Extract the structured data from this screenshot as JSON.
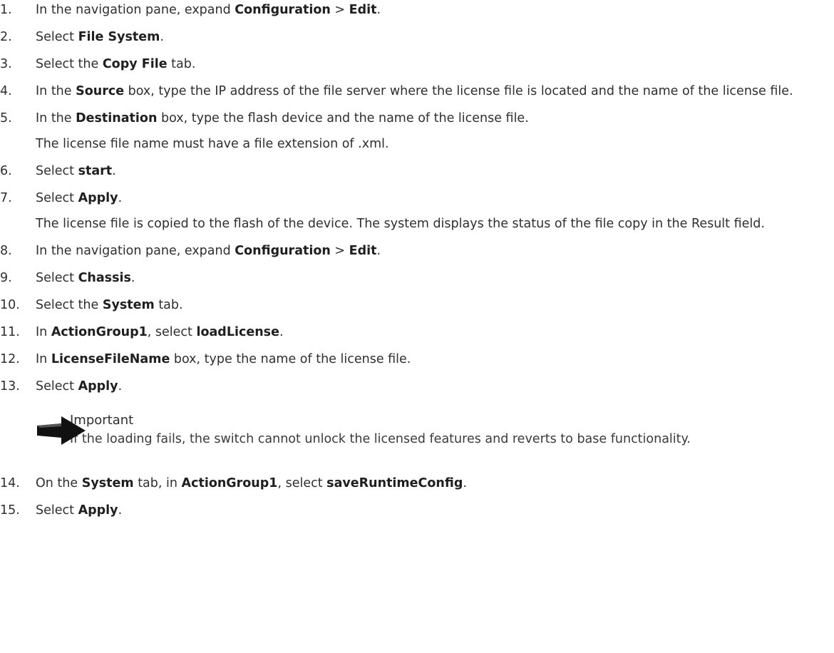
{
  "steps_a": [
    {
      "num": "1.",
      "parts": [
        {
          "t": "In the navigation pane, expand "
        },
        {
          "t": "Configuration",
          "b": true
        },
        {
          "t": " > "
        },
        {
          "t": "Edit",
          "b": true
        },
        {
          "t": "."
        }
      ]
    },
    {
      "num": "2.",
      "parts": [
        {
          "t": "Select "
        },
        {
          "t": "File System",
          "b": true
        },
        {
          "t": "."
        }
      ]
    },
    {
      "num": "3.",
      "parts": [
        {
          "t": "Select the "
        },
        {
          "t": "Copy File",
          "b": true
        },
        {
          "t": " tab."
        }
      ]
    },
    {
      "num": "4.",
      "parts": [
        {
          "t": "In the "
        },
        {
          "t": "Source",
          "b": true
        },
        {
          "t": " box, type the IP address of the file server where the license file is located and the name of the license file."
        }
      ]
    },
    {
      "num": "5.",
      "parts": [
        {
          "t": "In the "
        },
        {
          "t": "Destination",
          "b": true
        },
        {
          "t": " box, type the flash device and the name of the license file."
        }
      ],
      "note": "The license file name must have a file extension of .xml."
    },
    {
      "num": "6.",
      "parts": [
        {
          "t": "Select "
        },
        {
          "t": "start",
          "b": true
        },
        {
          "t": "."
        }
      ]
    },
    {
      "num": "7.",
      "parts": [
        {
          "t": "Select "
        },
        {
          "t": "Apply",
          "b": true
        },
        {
          "t": "."
        }
      ],
      "note": "The license file is copied to the flash of the device. The system displays the status of the file copy in the Result field."
    },
    {
      "num": "8.",
      "parts": [
        {
          "t": "In the navigation pane, expand "
        },
        {
          "t": "Configuration",
          "b": true
        },
        {
          "t": " > "
        },
        {
          "t": "Edit",
          "b": true
        },
        {
          "t": "."
        }
      ]
    },
    {
      "num": "9.",
      "parts": [
        {
          "t": "Select "
        },
        {
          "t": "Chassis",
          "b": true
        },
        {
          "t": "."
        }
      ]
    },
    {
      "num": "10.",
      "parts": [
        {
          "t": "Select the "
        },
        {
          "t": "System",
          "b": true
        },
        {
          "t": " tab."
        }
      ]
    },
    {
      "num": "11.",
      "parts": [
        {
          "t": "In "
        },
        {
          "t": "ActionGroup1",
          "b": true
        },
        {
          "t": ", select "
        },
        {
          "t": "loadLicense",
          "b": true
        },
        {
          "t": "."
        }
      ]
    },
    {
      "num": "12.",
      "parts": [
        {
          "t": "In "
        },
        {
          "t": "LicenseFileName",
          "b": true
        },
        {
          "t": " box, type the name of the license file."
        }
      ]
    },
    {
      "num": "13.",
      "parts": [
        {
          "t": "Select "
        },
        {
          "t": "Apply",
          "b": true
        },
        {
          "t": "."
        }
      ]
    }
  ],
  "callout": {
    "icon": "arrow-right-icon",
    "title": "Important",
    "text": "If the loading fails, the switch cannot unlock the licensed features and reverts to base functionality."
  },
  "steps_b": [
    {
      "num": "14.",
      "parts": [
        {
          "t": "On the "
        },
        {
          "t": "System",
          "b": true
        },
        {
          "t": " tab, in "
        },
        {
          "t": "ActionGroup1",
          "b": true
        },
        {
          "t": ", select "
        },
        {
          "t": "saveRuntimeConfig",
          "b": true
        },
        {
          "t": "."
        }
      ]
    },
    {
      "num": "15.",
      "parts": [
        {
          "t": "Select "
        },
        {
          "t": "Apply",
          "b": true
        },
        {
          "t": "."
        }
      ]
    }
  ]
}
